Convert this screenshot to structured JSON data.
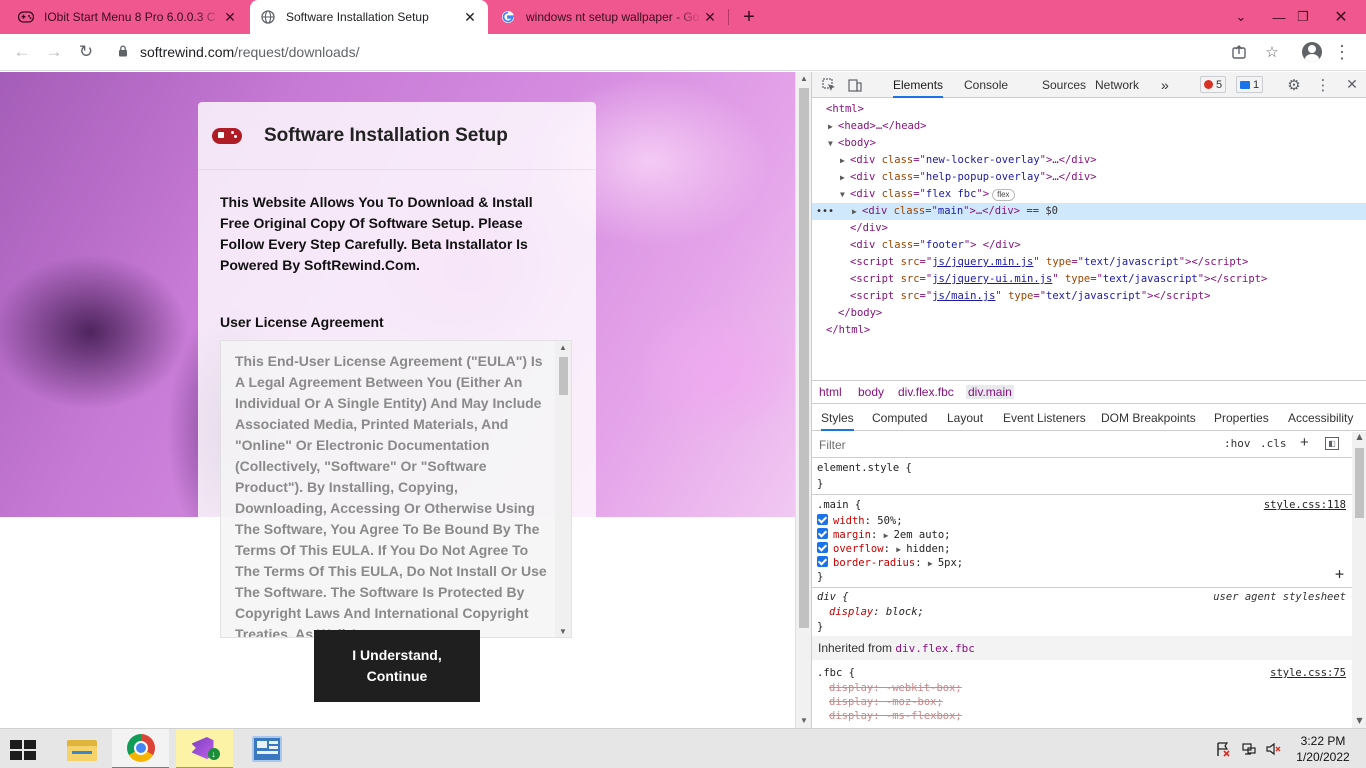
{
  "browser": {
    "tabs": [
      {
        "title": "IObit Start Menu 8 Pro 6.0.0.3 C",
        "icon": "iobit-gamepad-icon",
        "active": false
      },
      {
        "title": "Software Installation Setup",
        "icon": "globe-icon",
        "active": true
      },
      {
        "title": "windows nt setup wallpaper - Go",
        "icon": "google-icon",
        "active": false
      }
    ],
    "url_host": "softrewind.com",
    "url_path": "/request/downloads/"
  },
  "page": {
    "card_title": "Software Installation Setup",
    "intro": "This Website Allows You To Download & Install Free Original Copy Of Software Setup. Please Follow Every Step Carefully. Beta Installator Is Powered By SoftRewind.Com.",
    "eula_heading": "User License Agreement",
    "eula_text": "This End-User License Agreement (\"EULA\") Is A Legal Agreement Between You (Either An Individual Or A Single Entity) And May Include Associated Media, Printed Materials, And \"Online\" Or Electronic Documentation (Collectively, \"Software\" Or \"Software Product\"). By Installing, Copying, Downloading, Accessing Or Otherwise Using The Software, You Agree To Be Bound By The Terms Of This EULA. If You Do Not Agree To The Terms Of This EULA, Do Not Install Or Use The Software. The Software Is Protected By Copyright Laws And International Copyright Treaties, As Well As",
    "continue_line1": "I Understand,",
    "continue_line2": "Continue"
  },
  "devtools": {
    "tabs": [
      "Elements",
      "Console",
      "Sources",
      "Network"
    ],
    "more": "»",
    "errors": "5",
    "messages": "1",
    "dom": {
      "html_open": "<html>",
      "head": "<head>…</head>",
      "body_open": "<body>",
      "div1_class": "new-locker-overlay",
      "div2_class": "help-popup-overlay",
      "div3_class": "flex fbc",
      "flex_badge": "flex",
      "div4_class": "main",
      "dollar0": "== $0",
      "div_close": "</div>",
      "footer_class": "footer",
      "script1_src": "js/jquery.min.js",
      "script2_src": "js/jquery-ui.min.js",
      "script3_src": "js/main.js",
      "script_type": "text/javascript",
      "body_close": "</body>",
      "html_close": "</html>"
    },
    "breadcrumbs": [
      "html",
      "body",
      "div.flex.fbc",
      "div.main"
    ],
    "subtabs": [
      "Styles",
      "Computed",
      "Layout",
      "Event Listeners",
      "DOM Breakpoints",
      "Properties",
      "Accessibility"
    ],
    "filter_placeholder": "Filter",
    "hov": ":hov",
    "cls": ".cls",
    "styles": {
      "element_style": "element.style {",
      "close_brace": "}",
      "main_selector": ".main {",
      "main_source": "style.css:118",
      "main_props": [
        {
          "name": "width",
          "value": "50%;"
        },
        {
          "name": "margin",
          "value": "2em auto;"
        },
        {
          "name": "overflow",
          "value": "hidden;"
        },
        {
          "name": "border-radius",
          "value": "5px;"
        }
      ],
      "div_selector": "div {",
      "div_source": "user agent stylesheet",
      "div_prop_name": "display",
      "div_prop_value": "block;",
      "inherited_label": "Inherited from",
      "inherited_selector": "div.flex.fbc",
      "fbc_selector": ".fbc {",
      "fbc_source": "style.css:75",
      "fbc_props": [
        "display: -webkit-box;",
        "display: -moz-box;",
        "display: -ms-flexbox;"
      ]
    }
  },
  "taskbar": {
    "time": "3:22 PM",
    "date": "1/20/2022"
  },
  "colors": {
    "tabstrip": "#f0578e",
    "accent": "#1a73e8",
    "button": "#1f1f1f"
  }
}
